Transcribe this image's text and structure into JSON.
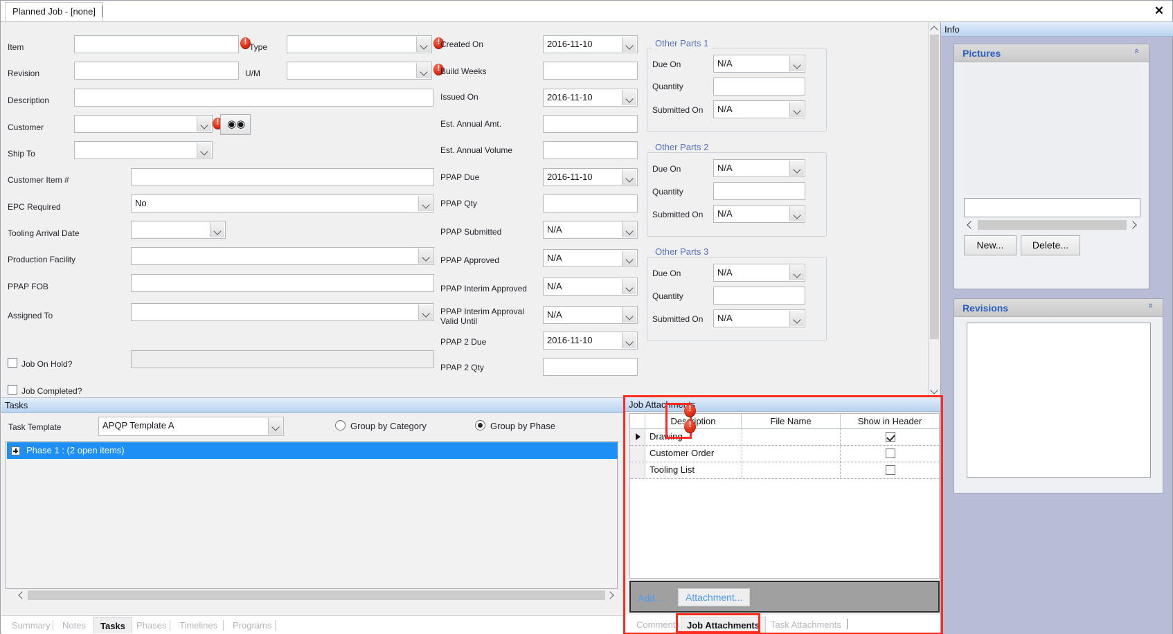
{
  "window": {
    "tab_title": "Planned Job - [none]",
    "close_icon": "close-icon"
  },
  "form": {
    "left_fields": [
      {
        "label": "Item",
        "value": "",
        "type": "text",
        "required": true
      },
      {
        "label": "Revision",
        "value": "",
        "type": "text",
        "required": false
      },
      {
        "label": "Description",
        "value": "",
        "type": "text",
        "required": false
      },
      {
        "label": "Customer",
        "value": "",
        "type": "combo",
        "required": true
      },
      {
        "label": "Ship To",
        "value": "",
        "type": "combo",
        "required": false
      },
      {
        "label": "Customer Item #",
        "value": "",
        "type": "text",
        "required": false
      },
      {
        "label": "EPC Required",
        "value": "No",
        "type": "combo",
        "required": false
      },
      {
        "label": "Tooling Arrival Date",
        "value": "",
        "type": "combo",
        "required": false
      },
      {
        "label": "Production Facility",
        "value": "",
        "type": "combo",
        "required": false
      },
      {
        "label": "PPAP FOB",
        "value": "",
        "type": "text",
        "required": false
      },
      {
        "label": "Assigned To",
        "value": "",
        "type": "combo",
        "required": false
      }
    ],
    "inline_fields": [
      {
        "label": "Type",
        "value": "",
        "type": "combo"
      },
      {
        "label": "U/M",
        "value": "",
        "type": "combo"
      }
    ],
    "checkboxes": [
      {
        "label": "Job On Hold?",
        "checked": false
      },
      {
        "label": "Job Completed?",
        "checked": false
      }
    ],
    "middle_fields": [
      {
        "label": "Created On",
        "value": "2016-11-10",
        "type": "combo",
        "required": true
      },
      {
        "label": "Build Weeks",
        "value": "",
        "type": "text",
        "required": true
      },
      {
        "label": "Issued On",
        "value": "2016-11-10",
        "type": "combo",
        "required": false
      },
      {
        "label": "Est. Annual Amt.",
        "value": "",
        "type": "text",
        "required": false
      },
      {
        "label": "Est. Annual Volume",
        "value": "",
        "type": "text",
        "required": false
      },
      {
        "label": "PPAP Due",
        "value": "2016-11-10",
        "type": "combo",
        "required": false
      },
      {
        "label": "PPAP Qty",
        "value": "",
        "type": "text",
        "required": false
      },
      {
        "label": "PPAP Submitted",
        "value": "N/A",
        "type": "combo",
        "required": false
      },
      {
        "label": "PPAP Approved",
        "value": "N/A",
        "type": "combo",
        "required": false
      },
      {
        "label": "PPAP Interim Approved",
        "value": "N/A",
        "type": "combo",
        "required": false
      },
      {
        "label": "PPAP Interim Approval Valid Until",
        "value": "N/A",
        "type": "combo",
        "required": false
      },
      {
        "label": "PPAP 2 Due",
        "value": "2016-11-10",
        "type": "combo",
        "required": false
      },
      {
        "label": "PPAP 2 Qty",
        "value": "",
        "type": "text",
        "required": false
      }
    ],
    "other_parts": [
      {
        "title": "Other Parts 1",
        "fields": [
          {
            "label": "Due On",
            "value": "N/A",
            "type": "combo"
          },
          {
            "label": "Quantity",
            "value": "",
            "type": "text"
          },
          {
            "label": "Submitted On",
            "value": "N/A",
            "type": "combo"
          }
        ]
      },
      {
        "title": "Other Parts 2",
        "fields": [
          {
            "label": "Due On",
            "value": "N/A",
            "type": "combo"
          },
          {
            "label": "Quantity",
            "value": "",
            "type": "text"
          },
          {
            "label": "Submitted On",
            "value": "N/A",
            "type": "combo"
          }
        ]
      },
      {
        "title": "Other Parts 3",
        "fields": [
          {
            "label": "Due On",
            "value": "N/A",
            "type": "combo"
          },
          {
            "label": "Quantity",
            "value": "",
            "type": "text"
          },
          {
            "label": "Submitted On",
            "value": "N/A",
            "type": "combo"
          }
        ]
      }
    ]
  },
  "tasks": {
    "panel_title": "Tasks",
    "template_label": "Task Template",
    "template_value": "APQP Template A",
    "group_by_category": "Group by Category",
    "group_by_phase": "Group by Phase",
    "group_selected": "Group by Phase",
    "tree_row": "Phase 1 : (2 open items)"
  },
  "bottom_tabs": {
    "items": [
      "Summary",
      "Notes",
      "Tasks",
      "Phases",
      "Timelines",
      "Programs"
    ],
    "active": "Tasks"
  },
  "job_attachments": {
    "panel_title": "Job Attachments",
    "columns": [
      "Description",
      "File Name",
      "Show in Header"
    ],
    "rows": [
      {
        "description": "Drawing",
        "file_name": "",
        "show_in_header": true,
        "selected": true,
        "warning": true
      },
      {
        "description": "Customer Order",
        "file_name": "",
        "show_in_header": false,
        "selected": false,
        "warning": true
      },
      {
        "description": "Tooling List",
        "file_name": "",
        "show_in_header": false,
        "selected": false,
        "warning": false
      }
    ],
    "add_label": "Add ...",
    "attachment_button": "Attachment...",
    "tabs": [
      "Comments",
      "Job Attachments",
      "Task Attachments"
    ],
    "active_tab": "Job Attachments",
    "highlight_color": "#ff2b1e"
  },
  "info_dock": {
    "header": "Info",
    "pictures": {
      "title": "Pictures",
      "filename_value": "",
      "new_button": "New...",
      "delete_button": "Delete..."
    },
    "revisions": {
      "title": "Revisions"
    }
  },
  "colors": {
    "accent_blue": "#2a5fc0",
    "group_title": "#5a6fbd",
    "selection_blue": "#1e90f5",
    "warning_red": "#e1301b",
    "highlight_red": "#ff2b1e"
  }
}
